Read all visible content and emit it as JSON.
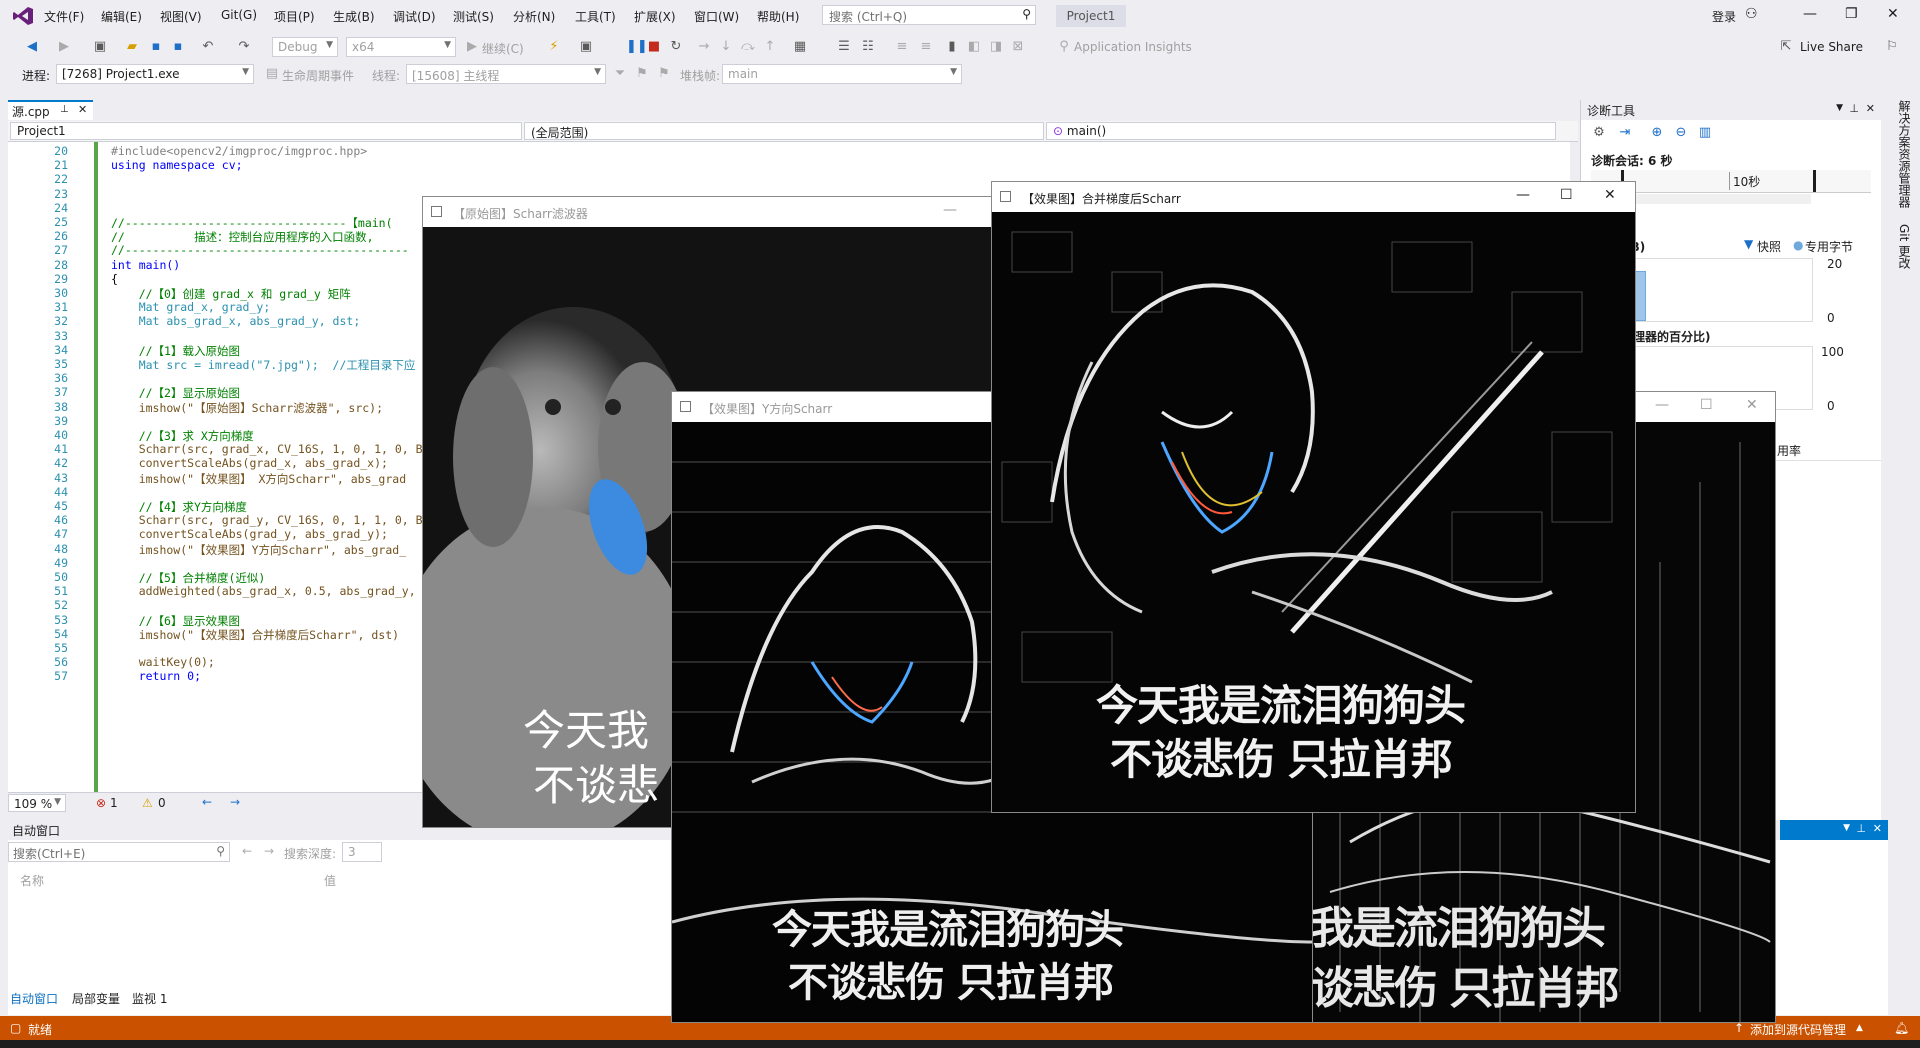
{
  "menubar": {
    "items": [
      "文件(F)",
      "编辑(E)",
      "视图(V)",
      "Git(G)",
      "项目(P)",
      "生成(B)",
      "调试(D)",
      "测试(S)",
      "分析(N)",
      "工具(T)",
      "扩展(X)",
      "窗口(W)",
      "帮助(H)"
    ],
    "search_placeholder": "搜索 (Ctrl+Q)",
    "project": "Project1",
    "login": "登录"
  },
  "toolbar": {
    "config": "Debug",
    "platform": "x64",
    "continue": "继续(C)",
    "insights": "Application Insights",
    "live_share": "Live Share"
  },
  "debugbar": {
    "process_label": "进程:",
    "process": "[7268] Project1.exe",
    "lifecycle": "生命周期事件",
    "thread_label": "线程:",
    "thread": "[15608] 主线程",
    "stack_label": "堆栈帧:",
    "stack": "main"
  },
  "editor": {
    "tab": "源.cpp",
    "project_combo": "Project1",
    "scope_combo": "(全局范围)",
    "func_combo": "main()",
    "lines": [
      {
        "n": "20",
        "t": "#include<opencv2/imgproc/imgproc.hpp>"
      },
      {
        "n": "21",
        "t": "using namespace cv;"
      },
      {
        "n": "22",
        "t": ""
      },
      {
        "n": "23",
        "t": ""
      },
      {
        "n": "24",
        "t": ""
      },
      {
        "n": "25",
        "t": "//--------------------------------【main("
      },
      {
        "n": "26",
        "t": "//          描述：控制台应用程序的入口函数,"
      },
      {
        "n": "27",
        "t": "//-----------------------------------------"
      },
      {
        "n": "28",
        "t": "int main()"
      },
      {
        "n": "29",
        "t": "{"
      },
      {
        "n": "30",
        "t": "    //【0】创建 grad_x 和 grad_y 矩阵"
      },
      {
        "n": "31",
        "t": "    Mat grad_x, grad_y;"
      },
      {
        "n": "32",
        "t": "    Mat abs_grad_x, abs_grad_y, dst;"
      },
      {
        "n": "33",
        "t": ""
      },
      {
        "n": "34",
        "t": "    //【1】载入原始图"
      },
      {
        "n": "35",
        "t": "    Mat src = imread(\"7.jpg\");  //工程目录下应"
      },
      {
        "n": "36",
        "t": ""
      },
      {
        "n": "37",
        "t": "    //【2】显示原始图"
      },
      {
        "n": "38",
        "t": "    imshow(\"【原始图】Scharr滤波器\", src);"
      },
      {
        "n": "39",
        "t": ""
      },
      {
        "n": "40",
        "t": "    //【3】求 X方向梯度"
      },
      {
        "n": "41",
        "t": "    Scharr(src, grad_x, CV_16S, 1, 0, 1, 0, B"
      },
      {
        "n": "42",
        "t": "    convertScaleAbs(grad_x, abs_grad_x);"
      },
      {
        "n": "43",
        "t": "    imshow(\"【效果图】 X方向Scharr\", abs_grad"
      },
      {
        "n": "44",
        "t": ""
      },
      {
        "n": "45",
        "t": "    //【4】求Y方向梯度"
      },
      {
        "n": "46",
        "t": "    Scharr(src, grad_y, CV_16S, 0, 1, 1, 0, B"
      },
      {
        "n": "47",
        "t": "    convertScaleAbs(grad_y, abs_grad_y);"
      },
      {
        "n": "48",
        "t": "    imshow(\"【效果图】Y方向Scharr\", abs_grad_"
      },
      {
        "n": "49",
        "t": ""
      },
      {
        "n": "50",
        "t": "    //【5】合并梯度(近似)"
      },
      {
        "n": "51",
        "t": "    addWeighted(abs_grad_x, 0.5, abs_grad_y,"
      },
      {
        "n": "52",
        "t": ""
      },
      {
        "n": "53",
        "t": "    //【6】显示效果图"
      },
      {
        "n": "54",
        "t": "    imshow(\"【效果图】合并梯度后Scharr\", dst)"
      },
      {
        "n": "55",
        "t": ""
      },
      {
        "n": "56",
        "t": "    waitKey(0);"
      },
      {
        "n": "57",
        "t": "    return 0;"
      }
    ],
    "zoom": "109 %",
    "errors": "1",
    "warnings": "0"
  },
  "diagnostics": {
    "title": "诊断工具",
    "session": "诊断会话: 6 秒",
    "timeline_label": "10秒",
    "memory_label": "存 (MB)",
    "snapshot": "快照",
    "private_bytes": "专用字节",
    "mem_max": "20",
    "mem_min": "0",
    "cpu_label": "所有处理器的百分比)",
    "cpu_max": "100",
    "cpu_min": "0",
    "usage": "用率",
    "side_tab1": "解决方案资源管理器",
    "side_tab2": "Git 更改"
  },
  "autos": {
    "title": "自动窗口",
    "search_placeholder": "搜索(Ctrl+E)",
    "depth_label": "搜索深度:",
    "depth": "3",
    "col_name": "名称",
    "col_value": "值",
    "tabs": [
      "自动窗口",
      "局部变量",
      "监视 1"
    ]
  },
  "statusbar": {
    "ready": "就绪",
    "source_control": "添加到源代码管理",
    "accent": "#ca5100"
  },
  "windows": {
    "original_title": "【原始图】Scharr滤波器",
    "y_title": "【效果图】Y方向Scharr",
    "merged_title": "【效果图】合并梯度后Scharr",
    "caption_line1": "今天我是流泪狗狗头",
    "caption_line2": "不谈悲伤 只拉肖邦",
    "orig_caption1": "今天我",
    "orig_caption2": "不谈悲"
  }
}
